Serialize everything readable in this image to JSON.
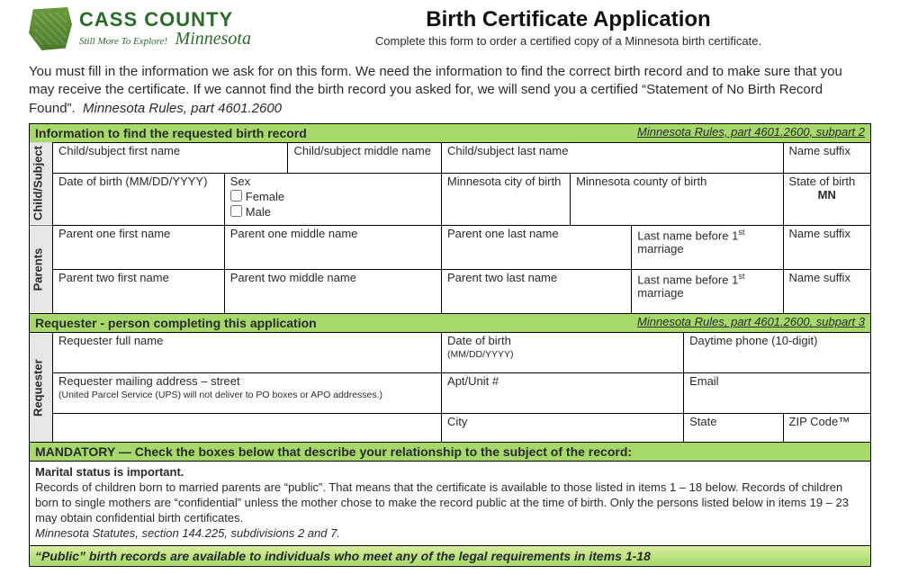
{
  "header": {
    "org_line1": "CASS COUNTY",
    "org_tagline": "Still More To Explore!",
    "org_state": "Minnesota",
    "title": "Birth Certificate Application",
    "subtitle": "Complete this form to order a certified copy of a Minnesota birth certificate."
  },
  "intro": {
    "text": "You must fill in the information we ask for on this form. We need the information to find the correct birth record and to make sure that you may receive the certificate. If we cannot find the birth record you asked for, we will send you a certified “Statement of No Birth Record Found”.",
    "citation": "Minnesota Rules, part 4601.2600"
  },
  "section1": {
    "title": "Information to find the requested birth record",
    "citation": "Minnesota Rules, part 4601.2600, subpart 2",
    "vlabel_child": "Child/Subject",
    "vlabel_parents": "Parents",
    "child": {
      "first": "Child/subject first name",
      "middle": "Child/subject middle name",
      "last": "Child/subject last name",
      "suffix": "Name suffix",
      "dob": "Date of birth (MM/DD/YYYY)",
      "sex": "Sex",
      "sex_f": "Female",
      "sex_m": "Male",
      "city": "Minnesota city of birth",
      "county": "Minnesota county of birth",
      "state_label": "State of birth",
      "state_value": "MN"
    },
    "p1": {
      "first": "Parent one first name",
      "middle": "Parent one middle name",
      "last": "Parent one last name",
      "maiden": "Last name before 1",
      "maiden_suffix": " marriage",
      "suffix": "Name suffix"
    },
    "p2": {
      "first": "Parent two first name",
      "middle": "Parent two middle name",
      "last": "Parent two last name",
      "maiden": "Last name before 1",
      "maiden_suffix": " marriage",
      "suffix": "Name suffix"
    }
  },
  "section2": {
    "title": "Requester - person completing this application",
    "citation": "Minnesota Rules, part 4601.2600, subpart 3",
    "vlabel": "Requester",
    "fullname": "Requester full name",
    "dob": "Date of birth",
    "dob_fmt": "(MM/DD/YYYY)",
    "phone": "Daytime phone (10-digit)",
    "street": "Requester mailing address – street",
    "street_note": "(United Parcel Service (UPS) will not deliver to PO boxes or APO addresses.)",
    "apt": "Apt/Unit #",
    "email": "Email",
    "city": "City",
    "state": "State",
    "zip": "ZIP Code™"
  },
  "mandatory": {
    "header": "MANDATORY — Check the boxes below that describe your relationship to the subject of the record:",
    "marital_h": "Marital status is important.",
    "body": "Records of children born to married parents are “public”. That means that the certificate is available to those listed in items 1 – 18 below. Records of children born to single mothers are “confidential” unless the mother chose to make the record public at the time of birth. Only the persons listed below in items 19 – 23 may obtain confidential birth certificates.",
    "cite": "Minnesota Statutes, section 144.225, subdivisions 2 and 7.",
    "public_strip": "“Public” birth records are available to individuals who meet any of the legal requirements in items 1-18"
  }
}
